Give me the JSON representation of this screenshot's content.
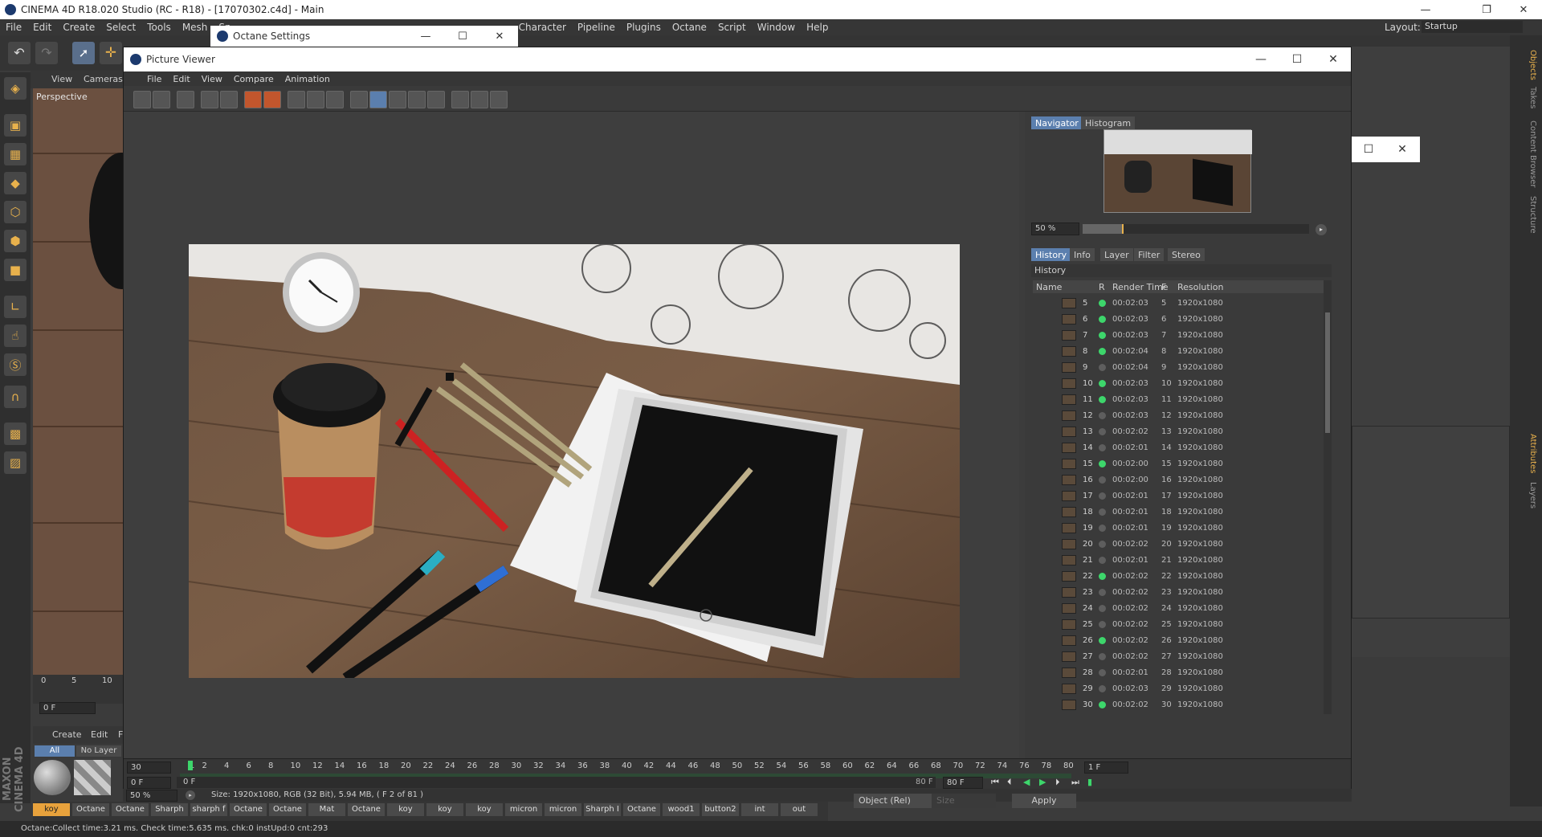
{
  "app_title": "CINEMA 4D R18.020 Studio (RC - R18) - [17070302.c4d] - Main",
  "layout_label": "Layout:",
  "layout_value": "Startup",
  "main_menu": [
    "File",
    "Edit",
    "Create",
    "Select",
    "Tools",
    "Mesh",
    "Sn",
    "Character",
    "Pipeline",
    "Plugins",
    "Octane",
    "Script",
    "Window",
    "Help"
  ],
  "viewport": {
    "menu": [
      "View",
      "Cameras"
    ],
    "label": "Perspective",
    "ruler": [
      "0",
      "5",
      "10"
    ],
    "frame_field": "0 F"
  },
  "right_tabs": [
    "Objects",
    "Takes",
    "Content Browser",
    "Structure",
    "Attributes",
    "Layers"
  ],
  "octane_window": {
    "title": "Octane Settings"
  },
  "picture_viewer": {
    "title": "Picture Viewer",
    "menu": [
      "File",
      "Edit",
      "View",
      "Compare",
      "Animation"
    ],
    "nav_tabs": [
      "Navigator",
      "Histogram"
    ],
    "zoom": "50 %",
    "hist_tabs": [
      "History",
      "Info",
      "Layer",
      "Filter",
      "Stereo"
    ],
    "history_label": "History",
    "columns": {
      "name": "Name",
      "r": "R",
      "render_time": "Render Time",
      "f": "F",
      "resolution": "Resolution"
    },
    "rows": [
      {
        "n": "5",
        "t": "00:02:03",
        "green": true
      },
      {
        "n": "6",
        "t": "00:02:03",
        "green": true
      },
      {
        "n": "7",
        "t": "00:02:03",
        "green": true
      },
      {
        "n": "8",
        "t": "00:02:04",
        "green": true
      },
      {
        "n": "9",
        "t": "00:02:04",
        "green": false
      },
      {
        "n": "10",
        "t": "00:02:03",
        "green": true
      },
      {
        "n": "11",
        "t": "00:02:03",
        "green": true
      },
      {
        "n": "12",
        "t": "00:02:03",
        "green": false
      },
      {
        "n": "13",
        "t": "00:02:02",
        "green": false
      },
      {
        "n": "14",
        "t": "00:02:01",
        "green": false
      },
      {
        "n": "15",
        "t": "00:02:00",
        "green": true
      },
      {
        "n": "16",
        "t": "00:02:00",
        "green": false
      },
      {
        "n": "17",
        "t": "00:02:01",
        "green": false
      },
      {
        "n": "18",
        "t": "00:02:01",
        "green": false
      },
      {
        "n": "19",
        "t": "00:02:01",
        "green": false
      },
      {
        "n": "20",
        "t": "00:02:02",
        "green": false
      },
      {
        "n": "21",
        "t": "00:02:01",
        "green": false
      },
      {
        "n": "22",
        "t": "00:02:02",
        "green": true
      },
      {
        "n": "23",
        "t": "00:02:02",
        "green": false
      },
      {
        "n": "24",
        "t": "00:02:02",
        "green": false
      },
      {
        "n": "25",
        "t": "00:02:02",
        "green": false
      },
      {
        "n": "26",
        "t": "00:02:02",
        "green": true
      },
      {
        "n": "27",
        "t": "00:02:02",
        "green": false
      },
      {
        "n": "28",
        "t": "00:02:01",
        "green": false
      },
      {
        "n": "29",
        "t": "00:02:03",
        "green": false
      },
      {
        "n": "30",
        "t": "00:02:02",
        "green": true
      }
    ],
    "resolution": "1920x1080",
    "timeline_start": "30",
    "timeline_ticks": [
      "1",
      "2",
      "4",
      "6",
      "8",
      "10",
      "12",
      "14",
      "16",
      "18",
      "20",
      "22",
      "24",
      "26",
      "28",
      "30",
      "32",
      "34",
      "36",
      "38",
      "40",
      "42",
      "44",
      "46",
      "48",
      "50",
      "52",
      "54",
      "56",
      "58",
      "60",
      "62",
      "64",
      "66",
      "68",
      "70",
      "72",
      "74",
      "76",
      "78",
      "80"
    ],
    "timeline_end": "1 F",
    "frame_field": "0 F",
    "frame_field2": "0 F",
    "frame_end_label": "80 F",
    "frame_end_field": "80 F",
    "bottom_zoom": "50 %",
    "status": "Size: 1920x1080, RGB (32 Bit), 5.94 MB,  ( F 2 of 81 )"
  },
  "materials": {
    "menu": [
      "Create",
      "Edit",
      "F"
    ],
    "filters": [
      "All",
      "No Layer"
    ],
    "names": [
      "koy",
      "Octane",
      "Octane",
      "Sharph",
      "sharph f",
      "Octane",
      "Octane",
      "Mat",
      "Octane",
      "koy",
      "koy",
      "koy",
      "micron",
      "micron",
      "Sharph I",
      "Octane",
      "wood1",
      "button2",
      "int",
      "out"
    ]
  },
  "attributes_bar": {
    "coord_mode": "Object (Rel)",
    "size": "Size",
    "apply": "Apply"
  },
  "brand": "MAXON CINEMA 4D",
  "bottom_status": "Octane:Collect time:3.21 ms.  Check time:5.635 ms.  chk:0  instUpd:0  cnt:293"
}
